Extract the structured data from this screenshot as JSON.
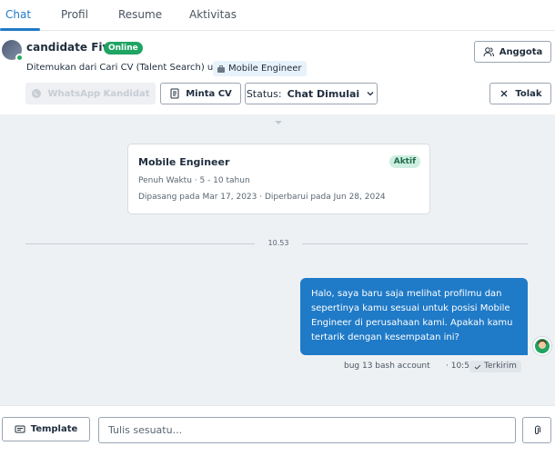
{
  "tabs": [
    {
      "label": "Chat"
    },
    {
      "label": "Profil"
    },
    {
      "label": "Resume"
    },
    {
      "label": "Aktivitas"
    }
  ],
  "header": {
    "candidate_name": "candidate Fivei",
    "online_badge": "Online",
    "found_text": "Ditemukan dari Cari CV (Talent Search) untuk",
    "job_chip": "Mobile Engineer",
    "anggota_label": "Anggota",
    "whatsapp_label": "WhatsApp Kandidat",
    "minta_cv_label": "Minta CV",
    "status_prefix": "Status:",
    "status_value": "Chat Dimulai",
    "tolak_label": "Tolak"
  },
  "job_card": {
    "title": "Mobile Engineer",
    "badge": "Aktif",
    "line1": "Penuh Waktu  ·  5 - 10 tahun",
    "line2": "Dipasang pada Mar 17, 2023  ·  Diperbarui pada Jun 28, 2024"
  },
  "divider_time": "10.53",
  "message": {
    "text": "Halo, saya baru saja melihat profilmu dan sepertinya kamu sesuai untuk posisi Mobile Engineer di perusahaan kami. Apakah kamu tertarik dengan kesempatan ini?",
    "sender": "bug 13 bash account",
    "time": "· 10:53",
    "status": "Terkirim"
  },
  "composer": {
    "template_label": "Template",
    "placeholder": "Tulis sesuatu..."
  },
  "colors": {
    "accent": "#1f7ac7",
    "online": "#1fa463"
  }
}
